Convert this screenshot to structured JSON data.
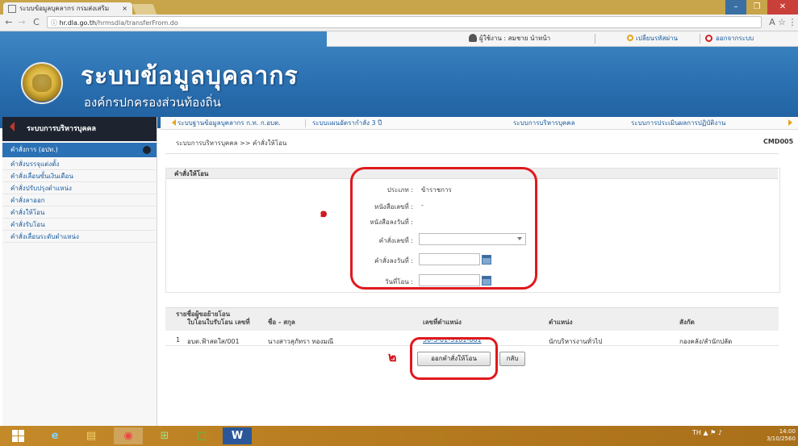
{
  "browser": {
    "tab_title": "ระบบข้อมูลบุคลากร กรมส่งเสริม",
    "tab_close": "×",
    "back": "←",
    "forward": "→",
    "reload": "C",
    "info": "ⓘ",
    "url_host": "hr.dla.go.th",
    "url_path": "/hrmsdla/transferFrom.do",
    "translate_icon": "A",
    "star": "☆",
    "menu": "⋮",
    "window_controls": [
      "–",
      "❐",
      "✕"
    ]
  },
  "header": {
    "user_label": "ผู้ใช้งาน : สมชาย นำหน้า",
    "change_password": "เปลี่ยนรหัสผ่าน",
    "logout": "ออกจากระบบ",
    "title": "ระบบข้อมูลบุคลากร",
    "subtitle": "องค์กรปกครองส่วนท้องถิ่น"
  },
  "sidebar": {
    "heading": "ระบบการบริหารบุคคล",
    "active_item": "คำสั่งการ (อปท.)",
    "items": [
      "คำสั่งบรรจุแต่งตั้ง",
      "คำสั่งเลื่อนขั้นเงินเดือน",
      "คำสั่งปรับปรุงตำแหน่ง",
      "คำสั่งลาออก",
      "คำสั่งให้โอน",
      "คำสั่งรับโอน",
      "คำสั่งเลื่อนระดับตำแหน่ง"
    ]
  },
  "main_nav": [
    "ระบบฐานข้อมูลบุคลากร ก.ท. ก.อบต.",
    "ระบบแผนอัตรากำลัง 3 ปี",
    "ระบบการบริหารบุคคล",
    "ระบบการประเมินผลการปฏิบัติงาน"
  ],
  "breadcrumb": "ระบบการบริหารบุคคล >> คำสั่งให้โอน",
  "page_code": "CMD005",
  "form": {
    "section_title": "คำสั่งให้โอน",
    "fields": [
      {
        "label": "ประเภท :",
        "value": "ข้าราชการ",
        "kind": "text"
      },
      {
        "label": "หนังสือเลขที่ :",
        "value": "-",
        "kind": "text"
      },
      {
        "label": "หนังสือลงวันที่ :",
        "value": "",
        "kind": "text"
      },
      {
        "label": "คำสั่งเลขที่ :",
        "value": "",
        "kind": "select"
      },
      {
        "label": "คำสั่งลงวันที่ :",
        "value": "",
        "kind": "date"
      },
      {
        "label": "วันที่โอน :",
        "value": "",
        "kind": "date"
      }
    ]
  },
  "annotations": {
    "marker_1": "๑",
    "marker_2": "๒"
  },
  "table": {
    "caption": "รายชื่อผู้ขอย้ายโอน",
    "headers": [
      "ใบโอนใบรับโอน เลขที่",
      "ชื่อ - สกุล",
      "เลขที่ตำแหน่ง",
      "ตำแหน่ง",
      "สังกัด"
    ],
    "rows": [
      {
        "no": "1",
        "doc": "อบต.ฟ้าสดใส/001",
        "name": "นางสาวสุภัทรา ทองมณี",
        "position_no": "50-3-01-3101-001",
        "position": "นักบริหารงานทั่วไป",
        "unit": "กองคลัง/สำนักปลัด"
      }
    ]
  },
  "buttons": {
    "issue_order": "ออกคำสั่งให้โอน",
    "back": "กลับ"
  },
  "taskbar": {
    "apps": [
      "e",
      "▤",
      "◉",
      "⊞",
      "▢",
      "W"
    ],
    "tray": "TH ▲ ⚑ ♪",
    "time": "14:00",
    "date": "3/10/2560"
  }
}
